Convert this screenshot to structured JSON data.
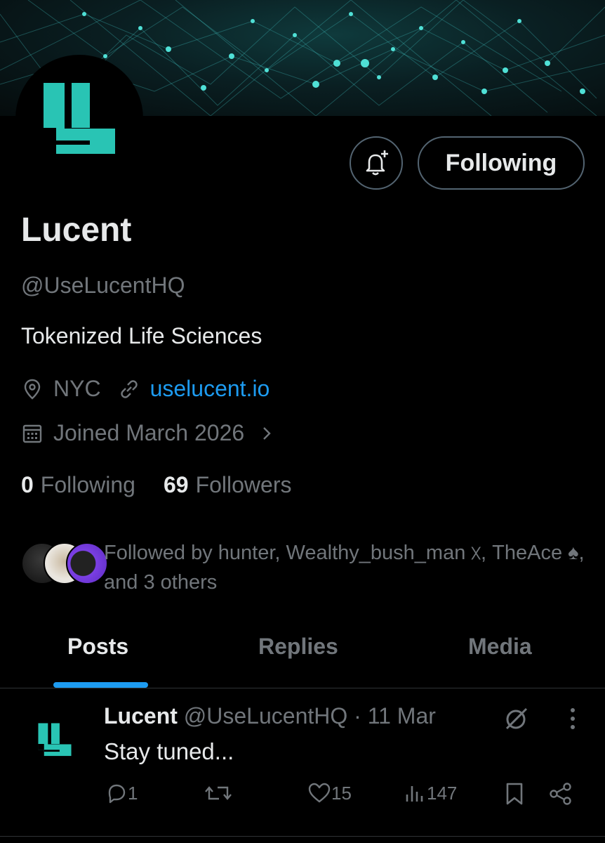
{
  "profile": {
    "name": "Lucent",
    "handle": "@UseLucentHQ",
    "bio": "Tokenized Life Sciences",
    "location": "NYC",
    "website": "uselucent.io",
    "joined": "Joined March 2026",
    "following_count": "0",
    "following_label": "Following",
    "followers_count": "69",
    "followers_label": "Followers",
    "followed_by": "Followed by hunter, Wealthy_bush_man ᳵ, TheAce ♠, and 3 others"
  },
  "actions": {
    "follow_button_label": "Following"
  },
  "tabs": [
    {
      "label": "Posts",
      "active": true
    },
    {
      "label": "Replies",
      "active": false
    },
    {
      "label": "Media",
      "active": false
    }
  ],
  "post": {
    "author_name": "Lucent",
    "author_handle": "@UseLucentHQ",
    "date": "· 11 Mar",
    "text": "Stay tuned...",
    "replies": "1",
    "likes": "15",
    "views": "147"
  },
  "colors": {
    "background": "#000000",
    "accent": "#1d9bf0",
    "brand_teal": "#29c4b4",
    "muted_text": "#71767b"
  }
}
